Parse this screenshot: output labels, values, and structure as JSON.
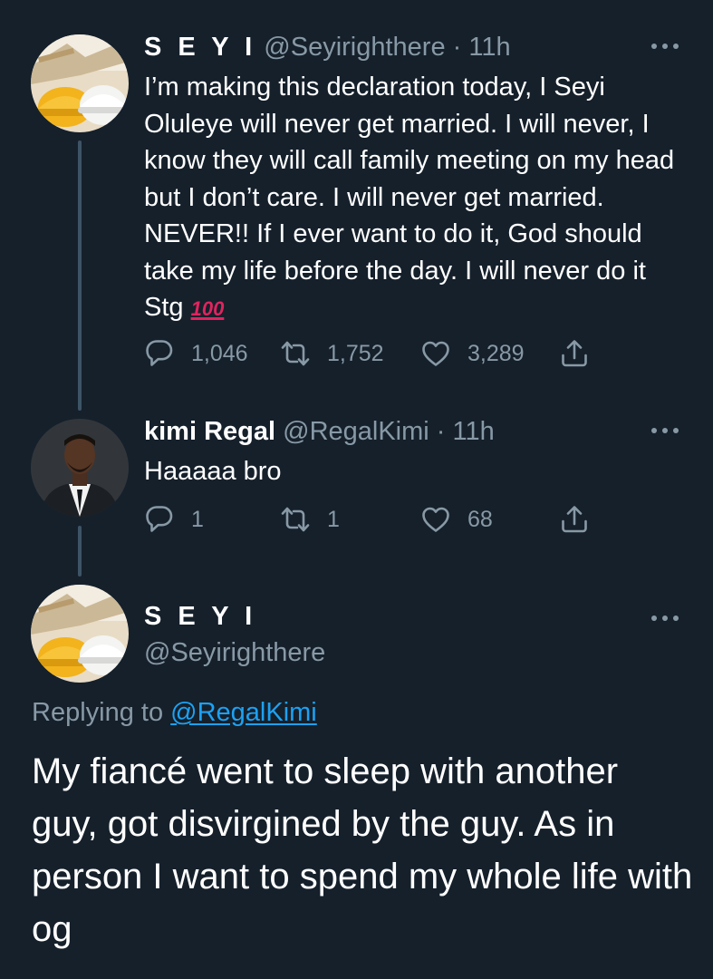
{
  "tweets": [
    {
      "name": "S E Y I",
      "handle": "@Seyirighthere",
      "time": "· 11h",
      "text": "I’m making this declaration today, I Seyi Oluleye will never get married. I will never, I know they will call family meeting on my head but I don’t care. I will never get married. NEVER!! If I ever want to do it, God should take my life before the day. I will never do it Stg",
      "emoji": "100",
      "replies": "1,046",
      "retweets": "1,752",
      "likes": "3,289"
    },
    {
      "name": "kimi Regal",
      "handle": "@RegalKimi",
      "time": "· 11h",
      "text": "Haaaaa bro",
      "replies": "1",
      "retweets": "1",
      "likes": "68"
    }
  ],
  "main_tweet": {
    "name": "S E Y I",
    "handle": "@Seyirighthere",
    "replying_prefix": "Replying to",
    "replying_to": "@RegalKimi",
    "text": "My fiancé went to sleep with another guy, got disvirgined by the guy. As in person I want to spend my whole life with og"
  },
  "icons": {
    "reply": "reply-icon",
    "retweet": "retweet-icon",
    "like": "heart-icon",
    "share": "share-icon",
    "more": "more-icon"
  },
  "colors": {
    "background": "#15202b",
    "muted": "#8899a6",
    "link": "#1da1f2",
    "emoji_red": "#e0245e"
  }
}
